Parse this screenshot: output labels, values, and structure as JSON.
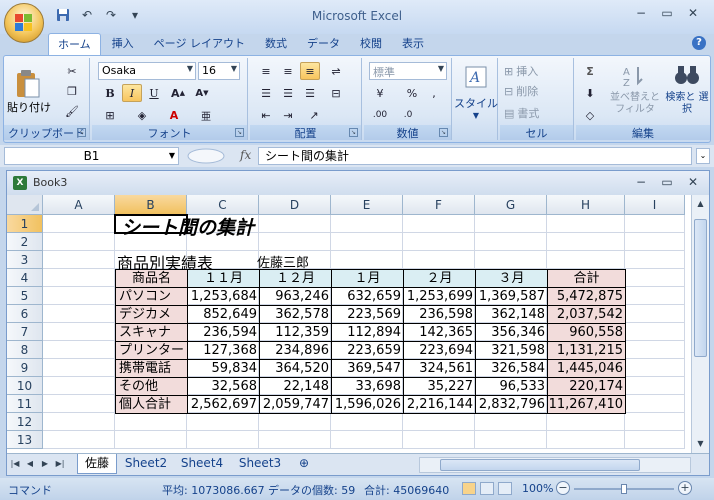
{
  "app": {
    "title": "Microsoft Excel"
  },
  "ribbon_tabs": [
    "ホーム",
    "挿入",
    "ページ レイアウト",
    "数式",
    "データ",
    "校閲",
    "表示"
  ],
  "ribbon": {
    "clipboard": {
      "label": "クリップボード",
      "paste": "貼り付け"
    },
    "font": {
      "label": "フォント",
      "name": "Osaka",
      "size": "16",
      "bold": "B",
      "italic": "I",
      "underline": "U"
    },
    "alignment": {
      "label": "配置"
    },
    "number": {
      "label": "数値",
      "format": "標準",
      "percent": "%"
    },
    "style": {
      "label": "スタイル"
    },
    "cells": {
      "label": "セル",
      "insert": "挿入",
      "delete": "削除",
      "format": "書式"
    },
    "editing": {
      "label": "編集",
      "sort": "並べ替えと フィルタ",
      "find": "検索と 選択",
      "sigma": "Σ"
    }
  },
  "formula_bar": {
    "name_box": "B1",
    "fx": "fx",
    "content": "シート間の集計"
  },
  "workbook": {
    "name": "Book3"
  },
  "columns": [
    "A",
    "B",
    "C",
    "D",
    "E",
    "F",
    "G",
    "H",
    "I"
  ],
  "rows": [
    "1",
    "2",
    "3",
    "4",
    "5",
    "6",
    "7",
    "8",
    "9",
    "10",
    "11",
    "12",
    "13"
  ],
  "sheet": {
    "title": "シート間の集計",
    "subtitle": "商品別実績表",
    "author": "佐藤三郎",
    "headers": [
      "商品名",
      "１１月",
      "１２月",
      "１月",
      "２月",
      "３月",
      "合計"
    ],
    "table": [
      [
        "パソコン",
        "1,253,684",
        "963,246",
        "632,659",
        "1,253,699",
        "1,369,587",
        "5,472,875"
      ],
      [
        "デジカメ",
        "852,649",
        "362,578",
        "223,569",
        "236,598",
        "362,148",
        "2,037,542"
      ],
      [
        "スキャナ",
        "236,594",
        "112,359",
        "112,894",
        "142,365",
        "356,346",
        "960,558"
      ],
      [
        "プリンター",
        "127,368",
        "234,896",
        "223,659",
        "223,694",
        "321,598",
        "1,131,215"
      ],
      [
        "携帯電話",
        "59,834",
        "364,520",
        "369,547",
        "324,561",
        "326,584",
        "1,445,046"
      ],
      [
        "その他",
        "32,568",
        "22,148",
        "33,698",
        "35,227",
        "96,533",
        "220,174"
      ],
      [
        "個人合計",
        "2,562,697",
        "2,059,747",
        "1,596,026",
        "2,216,144",
        "2,832,796",
        "11,267,410"
      ]
    ]
  },
  "sheet_tabs": [
    "佐藤",
    "Sheet2",
    "Sheet4",
    "Sheet3"
  ],
  "status": {
    "mode": "コマンド",
    "average": "平均: 1073086.667",
    "count": "データの個数: 59",
    "sum": "合計: 45069640",
    "zoom": "100%"
  }
}
